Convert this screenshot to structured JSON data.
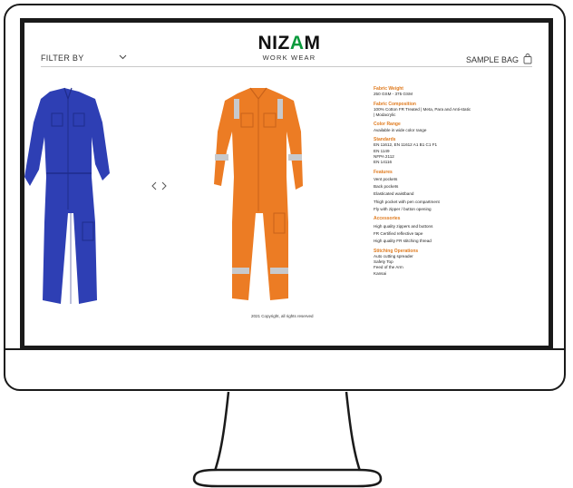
{
  "header": {
    "filter_label": "FILTER BY",
    "brand_prefix": "NIZ",
    "brand_mark": "A",
    "brand_suffix": "M",
    "brand_sub": "WORK WEAR",
    "sample_bag_label": "SAMPLE BAG"
  },
  "products": [
    {
      "color": "#2e3fb4",
      "shade": "#1f2c8c"
    },
    {
      "color": "#ec7c24",
      "shade": "#c9621a",
      "reflective": "#c7c9cc"
    }
  ],
  "specs": {
    "sections": [
      {
        "heading": "Fabric Weight",
        "lines": [
          "250 GSM - 375 GSM"
        ]
      },
      {
        "heading": "Fabric Composition",
        "lines": [
          "100% Cotton FR Treated | Meta, Para and Anti-static",
          "| Modacrylic"
        ]
      },
      {
        "heading": "Color Range",
        "lines": [
          "Available in wide color range"
        ]
      },
      {
        "heading": "Standards",
        "lines": [
          "EN 11612, EN 11612 A1 B1 C1 F1",
          "EN 1149",
          "NFPA 2112",
          "EN 14116"
        ]
      },
      {
        "heading": "Features",
        "lines": [
          "Vent pockets",
          "Back pockets",
          "Elasticated waistband",
          "Thigh pocket with pen compartment",
          "Fly with zipper / button opening"
        ]
      },
      {
        "heading": "Accessories",
        "lines": [
          "High quality zippers and buttons",
          "FR Certified reflective tape",
          "High quality FR stitching thread"
        ]
      },
      {
        "heading": "Stitching Operations",
        "lines": [
          "Auto cutting spreader",
          "Safety Top",
          "Feed of the Arm",
          "Kansai"
        ]
      }
    ]
  },
  "footer": {
    "copyright": "2021 Copyright, all rights reserved"
  },
  "icons": {
    "chevron": "chevron-down-icon",
    "bag": "shopping-bag-icon",
    "prev": "chevron-left-icon",
    "next": "chevron-right-icon"
  }
}
